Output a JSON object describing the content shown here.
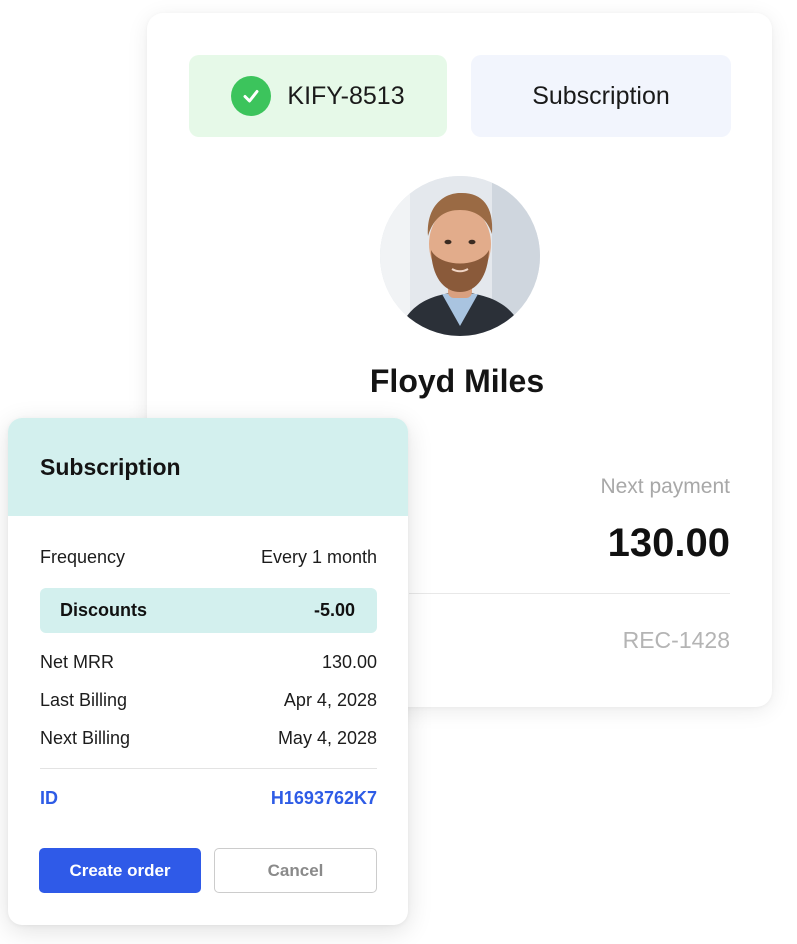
{
  "customer_card": {
    "status_code": "KIFY-8513",
    "type_label": "Subscription",
    "name": "Floyd Miles",
    "next_payment_label": "Next payment",
    "next_payment_amount": "130.00",
    "reference": "REC-1428"
  },
  "subscription_card": {
    "title": "Subscription",
    "frequency": {
      "label": "Frequency",
      "value": "Every 1 month"
    },
    "discounts": {
      "label": "Discounts",
      "value": "-5.00"
    },
    "net_mrr": {
      "label": "Net MRR",
      "value": "130.00"
    },
    "last_billing": {
      "label": "Last Billing",
      "value": "Apr 4, 2028"
    },
    "next_billing": {
      "label": "Next Billing",
      "value": "May 4, 2028"
    },
    "id": {
      "label": "ID",
      "value": "H1693762K7"
    },
    "create_button": "Create order",
    "cancel_button": "Cancel"
  },
  "colors": {
    "accent_blue": "#2f5ae8",
    "success_green": "#3cc45c",
    "teal_header": "#d3f0ee",
    "status_bg": "#e6f9e8"
  },
  "icons": [
    "check-icon",
    "avatar-photo"
  ]
}
